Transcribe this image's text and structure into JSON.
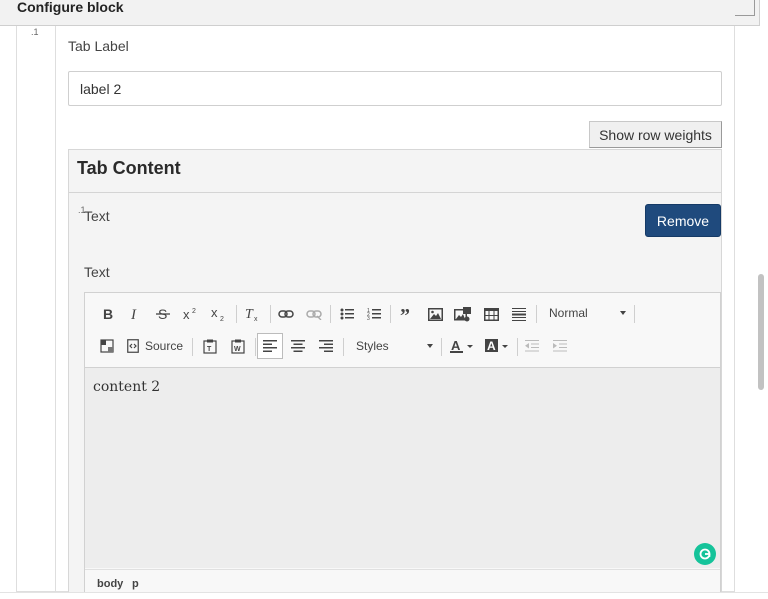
{
  "dialog": {
    "title": "Configure block"
  },
  "tab_label": {
    "label": "Tab Label",
    "value": "label 2"
  },
  "row_weights_button": "Show row weights",
  "tab_content": {
    "title": "Tab Content",
    "drag_mark": ".1",
    "row_label": "Text",
    "remove_button": "Remove",
    "editor_label": "Text"
  },
  "outer_drag_mark": ".1",
  "editor": {
    "format_combo": "Normal",
    "styles_combo": "Styles",
    "source_label": "Source",
    "content": "content 2",
    "path": [
      "body",
      "p"
    ]
  },
  "icons": [
    "bold-icon",
    "italic-icon",
    "strikethrough-icon",
    "superscript-icon",
    "subscript-icon",
    "remove-format-icon",
    "link-icon",
    "unlink-icon",
    "bulleted-list-icon",
    "numbered-list-icon",
    "blockquote-icon",
    "image-icon",
    "media-image-icon",
    "table-icon",
    "horizontal-rule-icon",
    "maximize-icon",
    "source-icon",
    "paste-text-icon",
    "paste-word-icon",
    "align-left-icon",
    "align-center-icon",
    "align-right-icon",
    "text-color-icon",
    "background-color-icon",
    "outdent-icon",
    "indent-icon",
    "grammarly-icon"
  ]
}
